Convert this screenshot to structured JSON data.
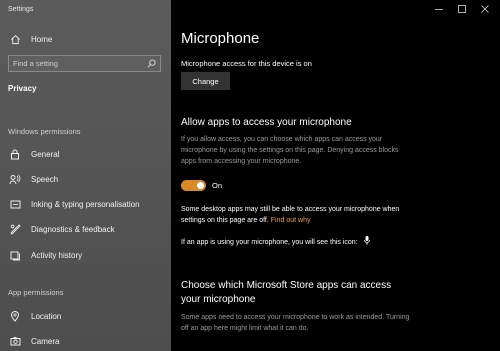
{
  "window": {
    "title": "Settings",
    "controls": [
      "minimize",
      "maximize",
      "close"
    ]
  },
  "sidebar": {
    "home_label": "Home",
    "search_placeholder": "Find a setting",
    "current_section": "Privacy",
    "windows_permissions_heading": "Windows permissions",
    "windows_permissions": [
      {
        "label": "General",
        "icon": "lock-icon"
      },
      {
        "label": "Speech",
        "icon": "speech-icon"
      },
      {
        "label": "Inking & typing personalisation",
        "icon": "inking-icon"
      },
      {
        "label": "Diagnostics & feedback",
        "icon": "diagnostics-icon"
      },
      {
        "label": "Activity history",
        "icon": "activity-icon"
      }
    ],
    "app_permissions_heading": "App permissions",
    "app_permissions": [
      {
        "label": "Location",
        "icon": "location-icon"
      },
      {
        "label": "Camera",
        "icon": "camera-icon"
      }
    ]
  },
  "main": {
    "title": "Microphone",
    "device_access_text": "Microphone access for this device is on",
    "change_button": "Change",
    "allow_heading": "Allow apps to access your microphone",
    "allow_description": "If you allow access, you can choose which apps can access your microphone by using the settings on this page. Denying access blocks apps from accessing your microphone.",
    "toggle_state": "On",
    "desktop_note": "Some desktop apps may still be able to access your microphone when settings on this page are off.",
    "find_out_why": "Find out why",
    "icon_note": "If an app is using your microphone, you will see this icon:",
    "store_heading_line1": "Choose which Microsoft Store apps can access",
    "store_heading_line2": "your microphone",
    "store_description": "Some apps need to access your microphone to work as intended. Turning off an app here might limit what it can do."
  },
  "colors": {
    "accent": "#d88a26",
    "link": "#e6a14a",
    "sidebar_bg": "#565656",
    "main_bg": "#000000"
  }
}
